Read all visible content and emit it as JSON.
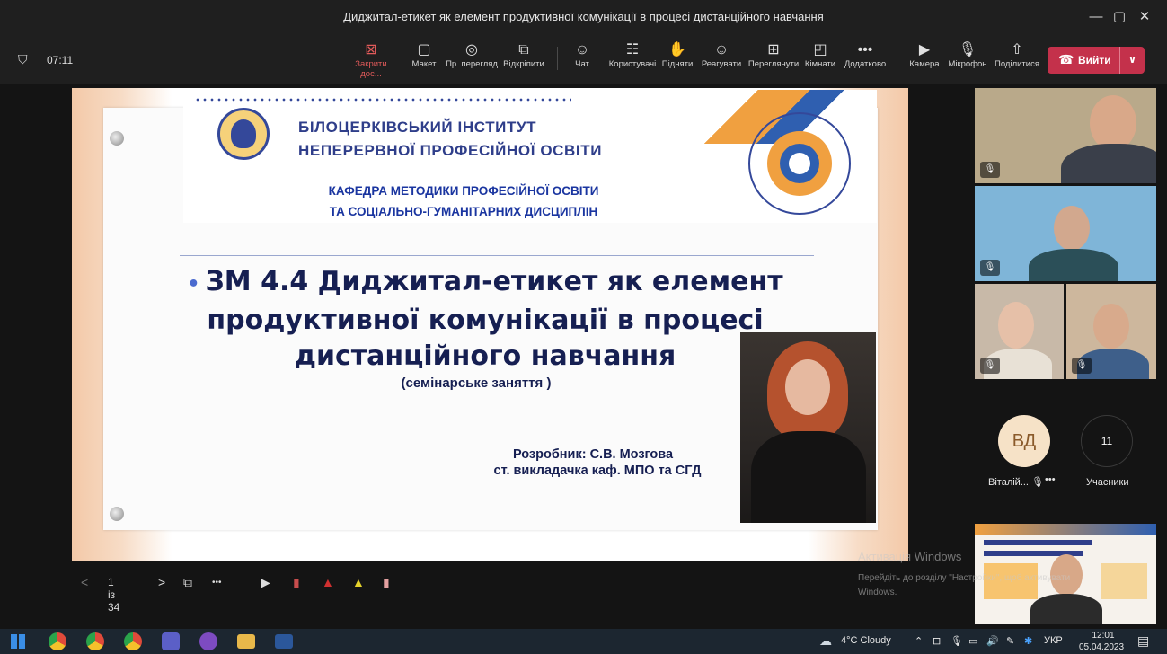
{
  "window": {
    "title": "Диджитал-етикет як елемент продуктивної комунікації в процесі дистанційного навчання",
    "min_label": "—",
    "max_label": "▢",
    "close_label": "✕"
  },
  "meeting": {
    "timer": "07:11",
    "shield_icon": "shield-icon"
  },
  "toolbar": {
    "items": [
      {
        "icon": "⊠",
        "label": "Закрити дос..."
      },
      {
        "icon": "▢",
        "label": "Макет"
      },
      {
        "icon": "◎",
        "label": "Пр. перегляд"
      },
      {
        "icon": "⧉",
        "label": "Відкріпити"
      },
      {
        "icon": "☺",
        "label": "Чат"
      },
      {
        "icon": "☷",
        "label": "Користувачі"
      },
      {
        "icon": "✋",
        "label": "Підняти"
      },
      {
        "icon": "☺",
        "label": "Реагувати"
      },
      {
        "icon": "⊞",
        "label": "Переглянути"
      },
      {
        "icon": "◰",
        "label": "Кімнати"
      },
      {
        "icon": "•••",
        "label": "Додатково"
      },
      {
        "icon": "▶",
        "label": "Камера"
      },
      {
        "icon": "🎙",
        "label": "Мікрофон"
      },
      {
        "icon": "⇧",
        "label": "Поділитися"
      }
    ],
    "leave_label": "Вийти",
    "leave_icon": "☎",
    "leave_dropdown": "∨",
    "accent": "#c4314b"
  },
  "slide": {
    "institute_line1": "БІЛОЦЕРКІВСЬКИЙ ІНСТИТУТ",
    "institute_line2": "НЕПЕРЕРВНОЇ ПРОФЕСІЙНОЇ ОСВІТИ",
    "dept_line1": "КАФЕДРА МЕТОДИКИ ПРОФЕСІЙНОЇ ОСВІТИ",
    "dept_line2": "ТА СОЦІАЛЬНО-ГУМАНІТАРНИХ ДИСЦИПЛІН",
    "bullet": "•",
    "title": "ЗМ 4.4 Диджитал-етикет як елемент продуктивної комунікації в процесі дистанційного навчання",
    "subtitle": "(семінарське заняття )",
    "author_line1": "Розробник: С.В. Мозгова",
    "author_line2": "ст. викладачка каф. МПО та СГД"
  },
  "slide_controls": {
    "prev": "<",
    "page": "1 із 34",
    "next": ">",
    "layout_icon": "⧉",
    "more": "•••"
  },
  "participants": {
    "vd_initials": "ВД",
    "vd_name": "Віталій...",
    "vd_more": "•••",
    "count": "11",
    "count_label": "Учасники"
  },
  "watermark": {
    "line1": "Активація Windows",
    "line2": "Перейдіть до розділу \"Настройки\", щоб активувати",
    "line3": "Windows."
  },
  "taskbar": {
    "weather": "4°C Cloudy",
    "lang": "УКР",
    "time": "12:01",
    "date": "05.04.2023"
  }
}
